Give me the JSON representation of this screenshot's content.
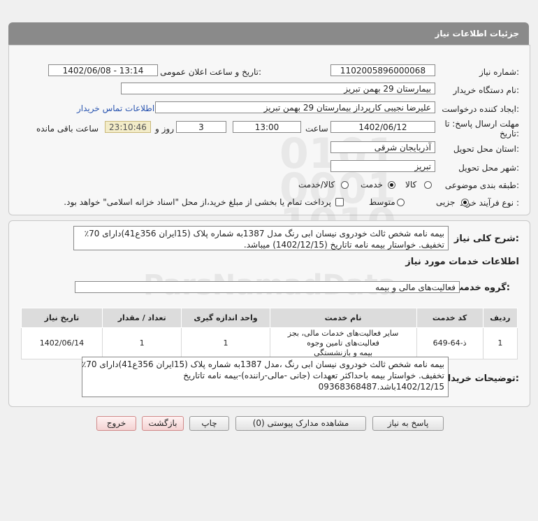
{
  "header": {
    "title": "جزئیات اطلاعات نیاز"
  },
  "form": {
    "need_number_label": "شماره نیاز:",
    "need_number": "1102005896000068",
    "announce_label": "تاریخ و ساعت اعلان عمومی:",
    "announce_value": "1402/06/08 - 13:14",
    "buyer_org_label": "نام دستگاه خریدار:",
    "buyer_org": "بیمارستان 29 بهمن تبریز",
    "requester_label": "ایجاد کننده درخواست:",
    "requester": "علیرضا نجیبی کارپرداز بیمارستان 29 بهمن تبریز",
    "contact_link": "اطلاعات تماس خریدار",
    "deadline_label_1": "مهلت ارسال پاسخ: تا",
    "deadline_label_2": "تاریخ:",
    "deadline_date": "1402/06/12",
    "time_label": "ساعت",
    "deadline_time": "13:00",
    "days_value": "3",
    "days_label": "روز و",
    "remaining_time": "23:10:46",
    "remaining_label": "ساعت باقی مانده",
    "province_label": "استان محل تحویل:",
    "province": "آذربایجان شرقی",
    "city_label": "شهر محل تحویل:",
    "city": "تبریز",
    "category_label": "طبقه بندی موضوعی:",
    "category_options": [
      "کالا",
      "خدمت",
      "کالا/خدمت"
    ],
    "category_selected": "خدمت",
    "process_label": "نوع فرآیند خرید :",
    "process_options": [
      "جزیی",
      "متوسط"
    ],
    "process_selected": "جزیی",
    "treasury_note": "پرداخت تمام یا بخشی از مبلغ خرید،از محل \"اسناد خزانه اسلامی\" خواهد بود."
  },
  "summary": {
    "label": "شرح کلی نیاز:",
    "text_line1": "بیمه نامه شخص ثالث خودروی نیسان ابی رنگ مدل 1387به شماره پلاک (15ایران 356ع41)دارای 70٪",
    "text_line2": "تخفیف. خواستار بیمه نامه تاتاریخ (1402/12/15) میباشد.",
    "services_title": "اطلاعات خدمات مورد نیاز",
    "service_group_label": "گروه خدمت:",
    "service_group": "فعالیت‌های مالی و بیمه"
  },
  "table": {
    "headers": [
      "ردیف",
      "کد خدمت",
      "نام خدمت",
      "واحد اندازه گیری",
      "تعداد / مقدار",
      "تاریخ نیاز"
    ],
    "rows": [
      {
        "row": "1",
        "code": "ذ-64-649",
        "name_line1": "سایر فعالیت‌های خدمات مالی، بجز فعالیت‌های تامین وجوه",
        "name_line2": "بیمه و بازنشستگی",
        "unit": "1",
        "qty": "1",
        "date": "1402/06/14"
      }
    ]
  },
  "buyer_notes": {
    "label": "توضیحات خریدار:",
    "line1": "بیمه نامه شخص ثالث خودروی نیسان ابی رنگ ،مدل 1387به شماره پلاک (15ایران 356ع41)دارای 70٪",
    "line2": "تخفیف. خواستار بیمه باحداکثر تعهدات (جانی -مالی-راننده)-بیمه نامه تاتاریخ",
    "line3": "1402/12/15باشد.09368368487"
  },
  "buttons": {
    "reply": "پاسخ به نیاز",
    "attachments": "مشاهده مدارک پیوستی (0)",
    "print": "چاپ",
    "back": "بازگشت",
    "exit": "خروج"
  }
}
